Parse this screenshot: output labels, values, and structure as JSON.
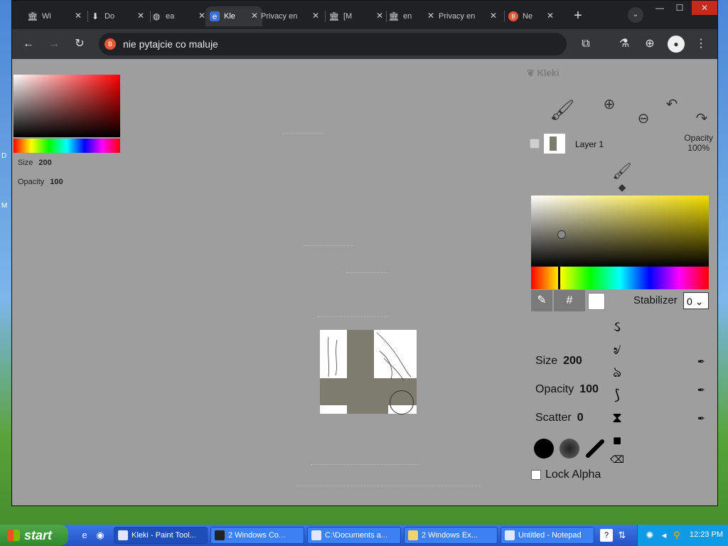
{
  "browser": {
    "tabs": [
      {
        "title": "Wi",
        "icon": "institution-icon"
      },
      {
        "title": "Do",
        "icon": "download-icon"
      },
      {
        "title": "ea",
        "icon": "globe-icon"
      },
      {
        "title": "Kle",
        "icon": "kleki-icon",
        "active": true
      },
      {
        "title": "Privacy en",
        "icon": "none"
      },
      {
        "title": "[M",
        "icon": "institution-icon"
      },
      {
        "title": "en",
        "icon": "institution-icon"
      },
      {
        "title": "Privacy en",
        "icon": "none"
      },
      {
        "title": "Ne",
        "icon": "brave-icon"
      }
    ],
    "url": "nie pytajcie co maluje",
    "controls": {
      "minimize": "—",
      "maximize": "☐",
      "close": "✕"
    }
  },
  "kleki": {
    "logo": "Kleki",
    "mini": {
      "size_label": "Size",
      "size_value": "200",
      "opacity_label": "Opacity",
      "opacity_value": "100"
    },
    "layer": {
      "name": "Layer 1",
      "opacity_label": "Opacity",
      "opacity_value": "100%"
    },
    "color": {
      "primary": "#ffffff",
      "hue_hex": "#f2dd00",
      "hex_button": "#"
    },
    "stabilizer": {
      "label": "Stabilizer",
      "value": "0"
    },
    "sliders": [
      {
        "label": "Size",
        "value": "200"
      },
      {
        "label": "Opacity",
        "value": "100"
      },
      {
        "label": "Scatter",
        "value": "0"
      }
    ],
    "lock_alpha": "Lock Alpha"
  },
  "taskbar": {
    "start": "start",
    "tasks": [
      {
        "label": "Kleki - Paint Tool...",
        "active": true
      },
      {
        "label": "2 Windows Co..."
      },
      {
        "label": "C:\\Documents a..."
      },
      {
        "label": "2 Windows Ex..."
      },
      {
        "label": "Untitled - Notepad"
      }
    ],
    "clock": "12:23 PM"
  }
}
